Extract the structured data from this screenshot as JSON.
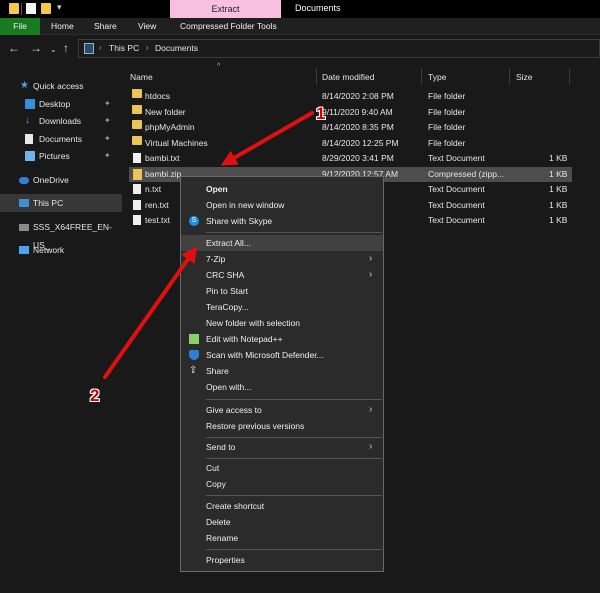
{
  "window": {
    "contextual_tab": "Extract",
    "title": "Documents",
    "quick_access_toolbar": [
      "folder-icon",
      "properties-icon",
      "new-folder-icon",
      "customize-dropdown-icon"
    ],
    "quick_access_dropdown": "▾"
  },
  "ribbon": {
    "tabs": [
      "File",
      "Home",
      "Share",
      "View",
      "Compressed Folder Tools"
    ],
    "file_tab_color": "#1a7a1f",
    "contextual_tab_color": "#f7bfe0"
  },
  "address": {
    "back": "←",
    "forward": "→",
    "recent": "⌄",
    "up": "↑",
    "crumbs": [
      "This PC",
      "Documents"
    ]
  },
  "nav_pane": {
    "items": [
      {
        "label": "Quick access",
        "icon": "star-icon"
      },
      {
        "label": "Desktop",
        "icon": "desktop-icon",
        "pinned": true
      },
      {
        "label": "Downloads",
        "icon": "download-icon",
        "pinned": true
      },
      {
        "label": "Documents",
        "icon": "documents-icon",
        "pinned": true
      },
      {
        "label": "Pictures",
        "icon": "pictures-icon",
        "pinned": true
      },
      {
        "label": "OneDrive",
        "icon": "cloud-icon"
      },
      {
        "label": "This PC",
        "icon": "computer-icon",
        "selected": true
      },
      {
        "label": "SSS_X64FREE_EN-US_",
        "icon": "drive-icon"
      },
      {
        "label": "Network",
        "icon": "network-icon"
      }
    ],
    "pin_glyph": "📌"
  },
  "file_list": {
    "columns": [
      "Name",
      "Date modified",
      "Type",
      "Size"
    ],
    "sort_arrow": "^",
    "rows": [
      {
        "name": "htdocs",
        "date": "8/14/2020 2:08 PM",
        "type": "File folder",
        "size": "",
        "icon": "folder-icon"
      },
      {
        "name": "New folder",
        "date": "9/11/2020 9:40 AM",
        "type": "File folder",
        "size": "",
        "icon": "folder-icon"
      },
      {
        "name": "phpMyAdmin",
        "date": "8/14/2020 8:35 PM",
        "type": "File folder",
        "size": "",
        "icon": "folder-icon"
      },
      {
        "name": "Virtual Machines",
        "date": "8/14/2020 12:25 PM",
        "type": "File folder",
        "size": "",
        "icon": "folder-icon"
      },
      {
        "name": "bambi.txt",
        "date": "8/29/2020 3:41 PM",
        "type": "Text Document",
        "size": "1 KB",
        "icon": "text-file-icon"
      },
      {
        "name": "bambi.zip",
        "date": "9/12/2020 12:57 AM",
        "type": "Compressed (zipp...",
        "size": "1 KB",
        "icon": "zip-file-icon",
        "selected": true
      },
      {
        "name": "n.txt",
        "date": "",
        "type": "Text Document",
        "size": "1 KB",
        "icon": "text-file-icon"
      },
      {
        "name": "ren.txt",
        "date": "",
        "type": "Text Document",
        "size": "1 KB",
        "icon": "text-file-icon"
      },
      {
        "name": "test.txt",
        "date": "",
        "type": "Text Document",
        "size": "1 KB",
        "icon": "text-file-icon"
      }
    ]
  },
  "context_menu": {
    "items": [
      {
        "label": "Open",
        "bold": true
      },
      {
        "label": "Open in new window"
      },
      {
        "label": "Share with Skype",
        "icon": "skype-icon"
      },
      {
        "separator": true
      },
      {
        "label": "Extract All...",
        "highlighted": true
      },
      {
        "label": "7-Zip",
        "submenu": true
      },
      {
        "label": "CRC SHA",
        "submenu": true
      },
      {
        "label": "Pin to Start"
      },
      {
        "label": "TeraCopy..."
      },
      {
        "label": "New folder with selection"
      },
      {
        "label": "Edit with Notepad++",
        "icon": "notepadpp-icon"
      },
      {
        "label": "Scan with Microsoft Defender...",
        "icon": "defender-shield-icon"
      },
      {
        "label": "Share",
        "icon": "share-icon"
      },
      {
        "label": "Open with..."
      },
      {
        "separator": true
      },
      {
        "label": "Give access to",
        "submenu": true
      },
      {
        "label": "Restore previous versions"
      },
      {
        "separator": true
      },
      {
        "label": "Send to",
        "submenu": true
      },
      {
        "separator": true
      },
      {
        "label": "Cut"
      },
      {
        "label": "Copy"
      },
      {
        "separator": true
      },
      {
        "label": "Create shortcut"
      },
      {
        "label": "Delete"
      },
      {
        "label": "Rename"
      },
      {
        "separator": true
      },
      {
        "label": "Properties"
      }
    ],
    "submenu_glyph": "›"
  },
  "annotations": {
    "step_1": "1",
    "step_2": "2",
    "arrow_color": "#e01010"
  }
}
